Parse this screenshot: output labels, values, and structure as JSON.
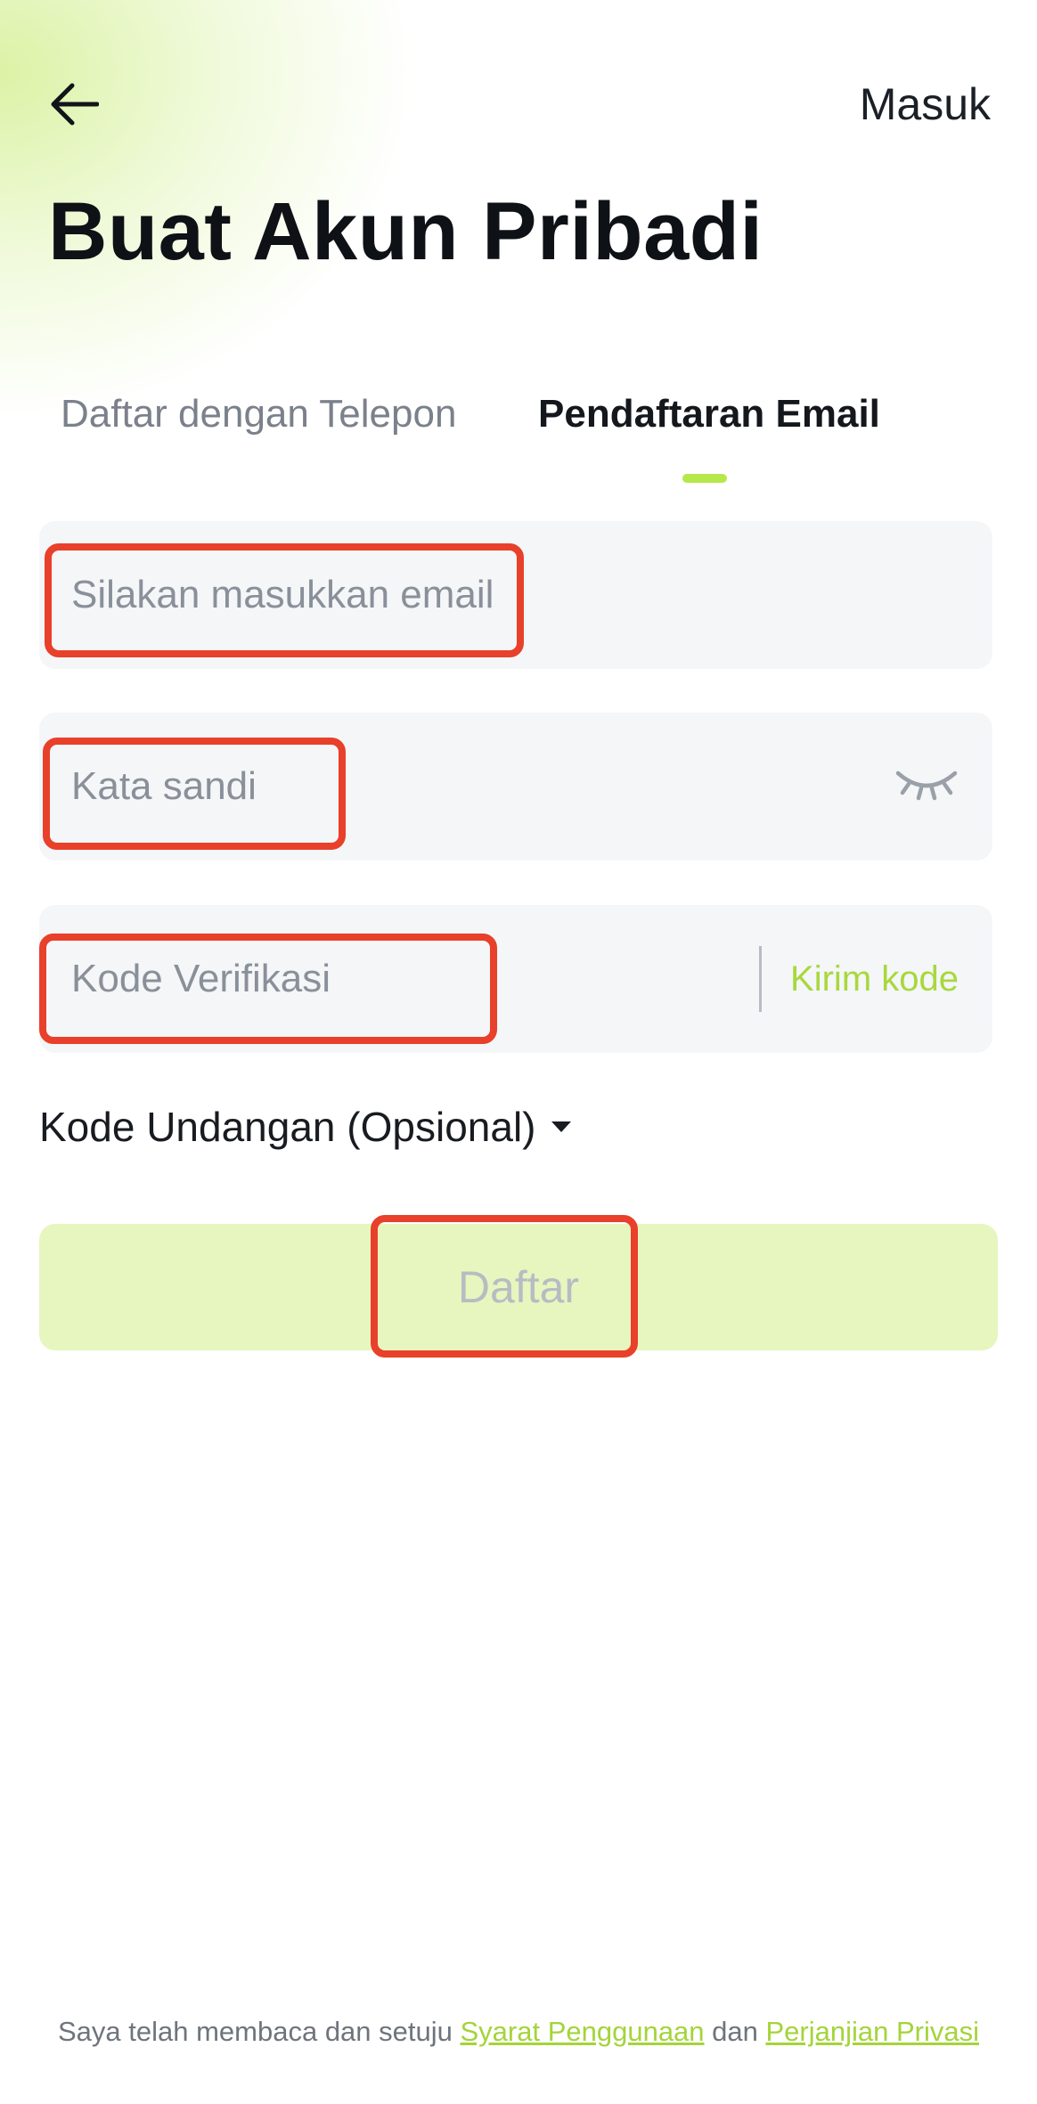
{
  "header": {
    "back_icon": "arrow-left-icon",
    "login_label": "Masuk"
  },
  "title": "Buat Akun Pribadi",
  "tabs": [
    {
      "label": "Daftar dengan Telepon",
      "active": false
    },
    {
      "label": "Pendaftaran Email",
      "active": true
    }
  ],
  "form": {
    "email": {
      "placeholder": "Silakan masukkan email",
      "value": ""
    },
    "password": {
      "placeholder": "Kata sandi",
      "value": "",
      "toggle_icon": "eye-closed-icon"
    },
    "code": {
      "placeholder": "Kode Verifikasi",
      "value": "",
      "send_label": "Kirim kode"
    },
    "invite_label": "Kode Undangan (Opsional)",
    "invite_icon": "caret-down-icon",
    "submit_label": "Daftar"
  },
  "terms": {
    "prefix": "Saya telah membaca dan setuju ",
    "terms_link": "Syarat Penggunaan",
    "middle": " dan ",
    "privacy_link": "Perjanjian Privasi"
  },
  "colors": {
    "accent": "#b6e84a",
    "link": "#a4d43a",
    "button_bg": "#e7f5bf",
    "highlight": "#e8402a"
  }
}
